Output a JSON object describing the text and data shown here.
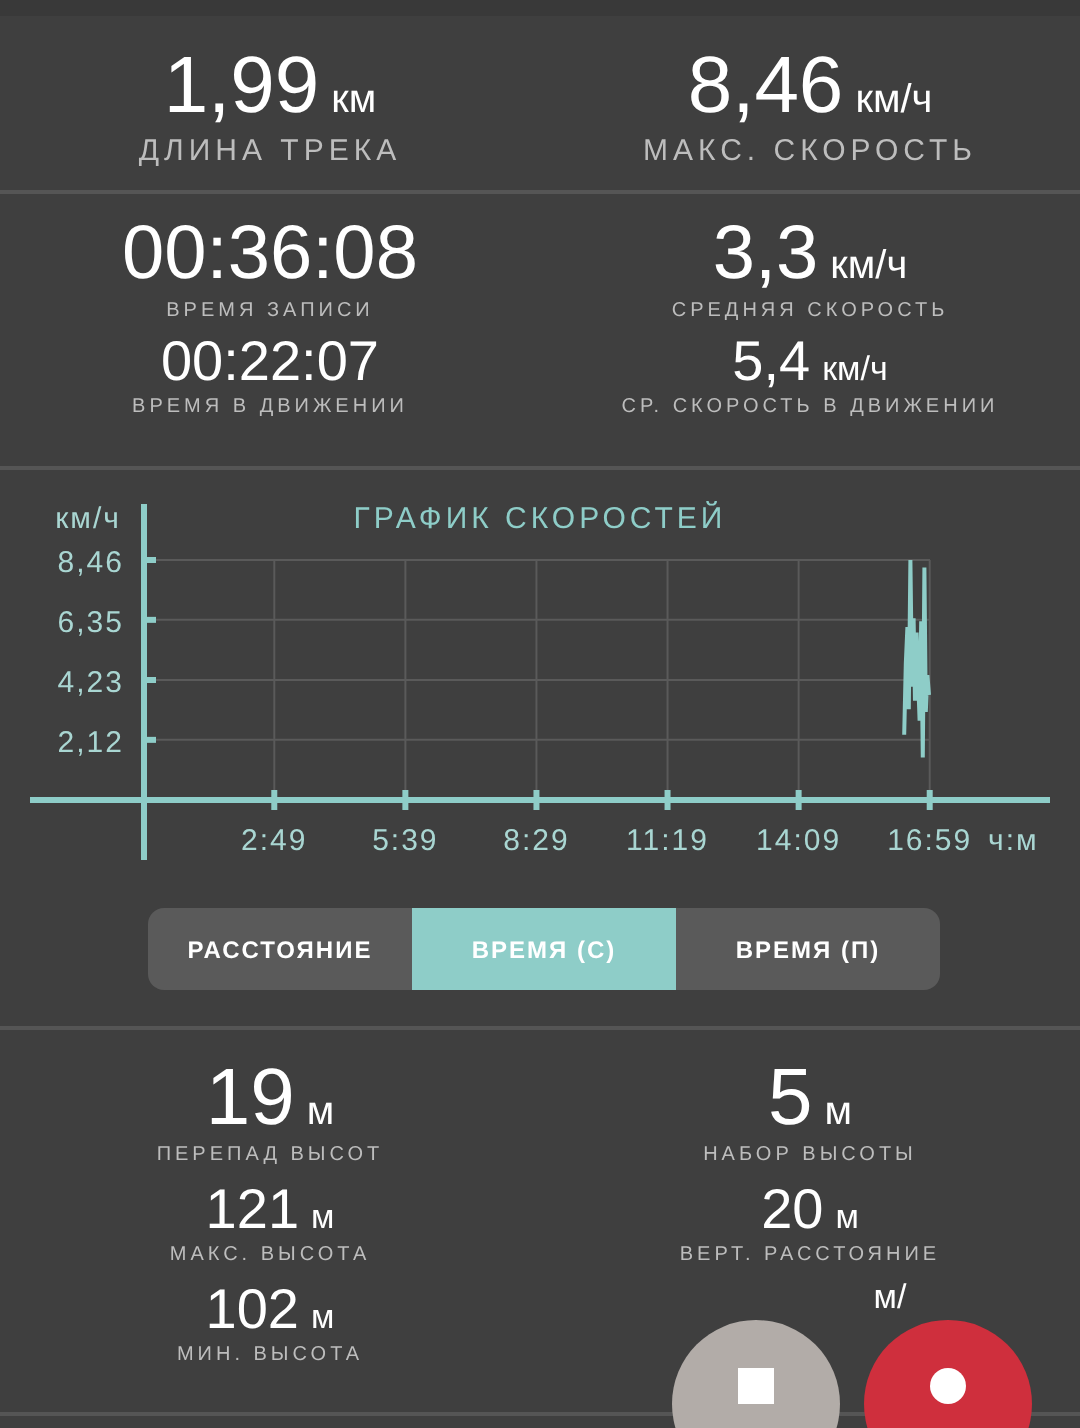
{
  "summary": [
    {
      "kind": "hero",
      "value": "1,99",
      "unit": "км",
      "label": "ДЛИНА ТРЕКА"
    },
    {
      "kind": "hero",
      "value": "8,46",
      "unit": "км/ч",
      "label": "МАКС. СКОРОСТЬ"
    }
  ],
  "timing": [
    [
      {
        "kind": "primary",
        "value": "00:36:08",
        "label": "ВРЕМЯ ЗАПИСИ"
      },
      {
        "kind": "secondary",
        "value": "00:22:07",
        "label": "ВРЕМЯ В ДВИЖЕНИИ"
      }
    ],
    [
      {
        "kind": "primary",
        "value": "3,3",
        "unit": "км/ч",
        "label": "СРЕДНЯЯ СКОРОСТЬ"
      },
      {
        "kind": "secondary",
        "value": "5,4",
        "unit": "км/ч",
        "label": "СР. СКОРОСТЬ В ДВИЖЕНИИ"
      }
    ]
  ],
  "chart": {
    "chart_data": {
      "type": "line",
      "title": "ГРАФИК СКОРОСТЕЙ",
      "ylabel": "км/ч",
      "xlabel": "ч:м",
      "ylim": [
        0,
        8.46
      ],
      "xlim": [
        -147.8,
        1175
      ],
      "grid": true,
      "yticks": [
        {
          "value": 2.12,
          "label": "2,12"
        },
        {
          "value": 4.23,
          "label": "4,23"
        },
        {
          "value": 6.35,
          "label": "6,35"
        },
        {
          "value": 8.46,
          "label": "8,46"
        }
      ],
      "xticks": [
        {
          "value": 169,
          "label": "2:49"
        },
        {
          "value": 339,
          "label": "5:39"
        },
        {
          "value": 509,
          "label": "8:29"
        },
        {
          "value": 679,
          "label": "11:19"
        },
        {
          "value": 849,
          "label": "14:09"
        },
        {
          "value": 1019,
          "label": "16:59"
        }
      ],
      "series": [
        {
          "color": "#8ecdc8",
          "x": [
            986,
            988,
            990,
            992,
            994,
            996,
            998,
            1000,
            1002,
            1004,
            1006,
            1008,
            1010,
            1012,
            1014,
            1016,
            1018
          ],
          "values": [
            2.3,
            4.8,
            6.1,
            3.2,
            8.46,
            4.0,
            6.4,
            3.5,
            5.9,
            4.2,
            2.8,
            6.3,
            1.5,
            8.2,
            3.1,
            4.4,
            3.7
          ]
        }
      ]
    }
  },
  "modes": [
    {
      "label": "РАССТОЯНИЕ",
      "selected": false
    },
    {
      "label": "ВРЕМЯ (С)",
      "selected": true
    },
    {
      "label": "ВРЕМЯ (П)",
      "selected": false
    }
  ],
  "elevation": [
    [
      {
        "kind": "primary",
        "value": "19",
        "unit": "м",
        "label": "ПЕРЕПАД ВЫСОТ"
      },
      {
        "kind": "secondary",
        "value": "121",
        "unit": "м",
        "label": "МАКС. ВЫСОТА"
      },
      {
        "kind": "secondary",
        "value": "102",
        "unit": "м",
        "label": "МИН. ВЫСОТА"
      }
    ],
    [
      {
        "kind": "primary",
        "value": "5",
        "unit": "м",
        "label": "НАБОР ВЫСОТЫ"
      },
      {
        "kind": "secondary",
        "value": "20",
        "unit": "м",
        "label": "ВЕРТ. РАССТОЯНИЕ"
      },
      {
        "kind": "secondary",
        "unit": "м/"
      }
    ]
  ]
}
